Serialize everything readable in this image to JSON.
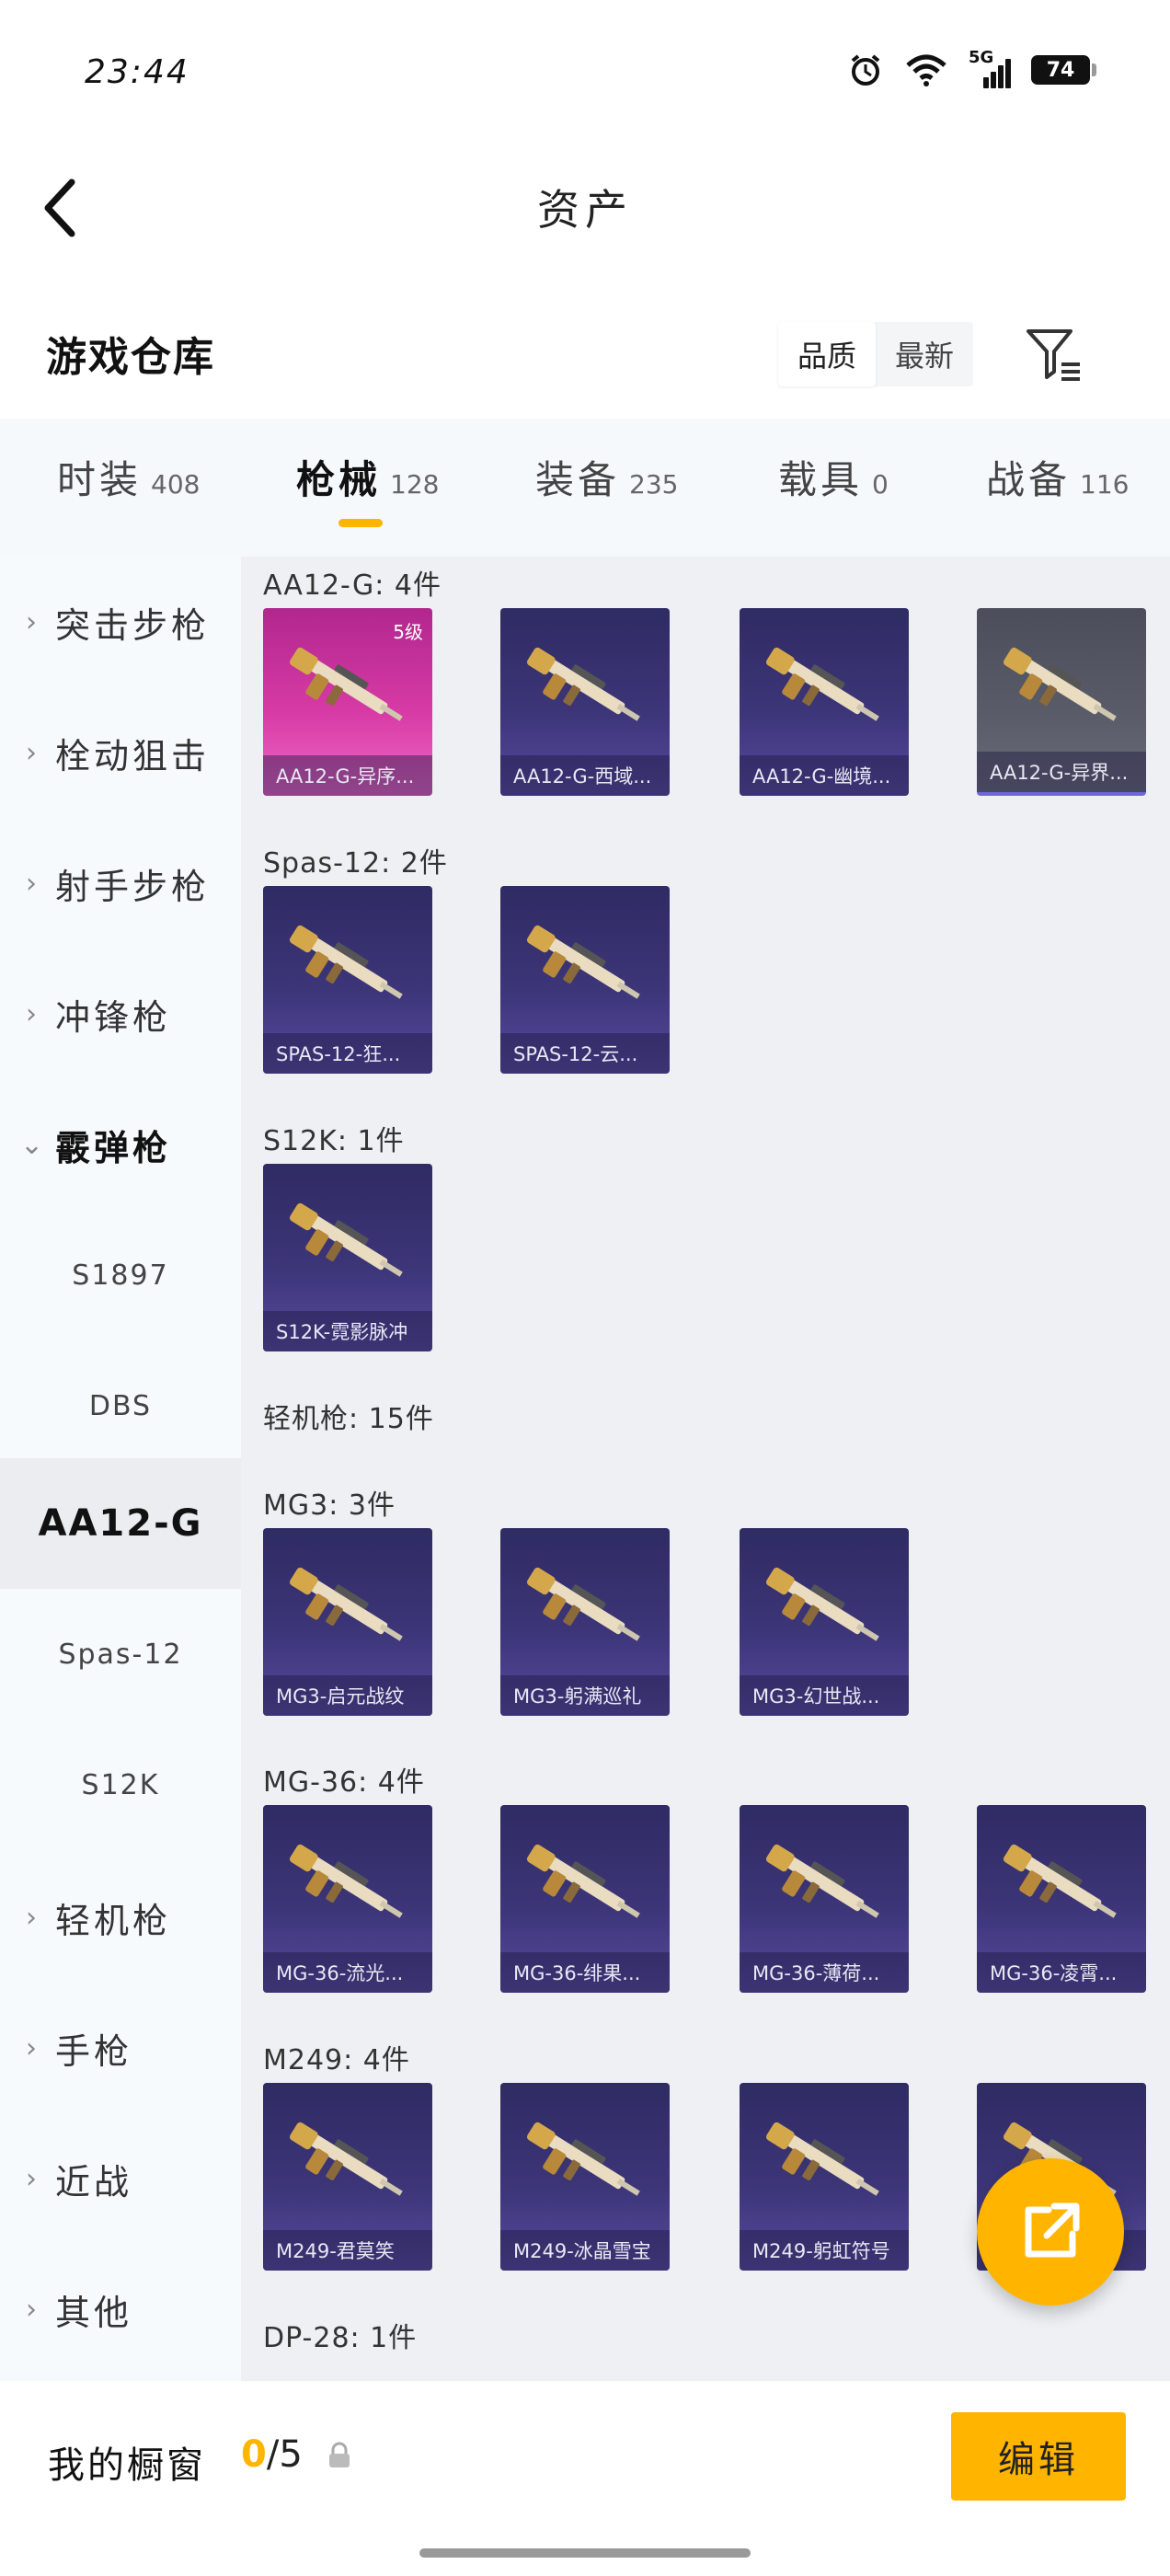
{
  "status_bar": {
    "time": "23:44",
    "network": "5G",
    "battery": "74"
  },
  "header": {
    "title": "资产"
  },
  "warehouse": {
    "title": "游戏仓库",
    "sort_options": [
      {
        "label": "品质",
        "active": true
      },
      {
        "label": "最新",
        "active": false
      }
    ]
  },
  "tabs": [
    {
      "label": "时装",
      "count": "408"
    },
    {
      "label": "枪械",
      "count": "128",
      "active": true
    },
    {
      "label": "装备",
      "count": "235"
    },
    {
      "label": "载具",
      "count": "0"
    },
    {
      "label": "战备",
      "count": "116"
    }
  ],
  "sidebar": {
    "items": [
      {
        "label": "突击步枪"
      },
      {
        "label": "栓动狙击"
      },
      {
        "label": "射手步枪"
      },
      {
        "label": "冲锋枪"
      },
      {
        "label": "霰弹枪",
        "expanded": true
      },
      {
        "label": "S1897",
        "sub": true
      },
      {
        "label": "DBS",
        "sub": true
      },
      {
        "label": "AA12-G",
        "sub": true,
        "active": true
      },
      {
        "label": "Spas-12",
        "sub": true
      },
      {
        "label": "S12K",
        "sub": true
      },
      {
        "label": "轻机枪"
      },
      {
        "label": "手枪"
      },
      {
        "label": "近战"
      },
      {
        "label": "其他"
      }
    ]
  },
  "groups": [
    {
      "label": "AA12-G: 4件",
      "items": [
        {
          "name": "AA12-G-异序...",
          "tier": "5级",
          "theme": "pink"
        },
        {
          "name": "AA12-G-西域...",
          "theme": "purple"
        },
        {
          "name": "AA12-G-幽境...",
          "theme": "purple"
        },
        {
          "name": "AA12-G-异界...",
          "theme": "gray"
        }
      ]
    },
    {
      "label": "Spas-12: 2件",
      "items": [
        {
          "name": "SPAS-12-狂...",
          "theme": "purple"
        },
        {
          "name": "SPAS-12-云...",
          "theme": "purple"
        }
      ]
    },
    {
      "label": "S12K: 1件",
      "items": [
        {
          "name": "S12K-霓影脉冲",
          "theme": "purple"
        }
      ]
    },
    {
      "label": "轻机枪: 15件",
      "items": []
    },
    {
      "label": "MG3: 3件",
      "items": [
        {
          "name": "MG3-启元战纹",
          "theme": "purple"
        },
        {
          "name": "MG3-躬满巡礼",
          "theme": "purple"
        },
        {
          "name": "MG3-幻世战...",
          "theme": "purple"
        }
      ]
    },
    {
      "label": "MG-36: 4件",
      "items": [
        {
          "name": "MG-36-流光...",
          "theme": "purple"
        },
        {
          "name": "MG-36-绯果...",
          "theme": "purple"
        },
        {
          "name": "MG-36-薄荷...",
          "theme": "purple"
        },
        {
          "name": "MG-36-凌霄...",
          "theme": "purple"
        }
      ]
    },
    {
      "label": "M249: 4件",
      "items": [
        {
          "name": "M249-君莫笑",
          "theme": "purple"
        },
        {
          "name": "M249-冰晶雪宝",
          "theme": "purple"
        },
        {
          "name": "M249-躬虹符号",
          "theme": "purple"
        },
        {
          "name": "M249-...灯",
          "theme": "purple"
        }
      ]
    },
    {
      "label": "DP-28: 1件",
      "items": []
    }
  ],
  "bottom": {
    "showcase_label": "我的橱窗",
    "showcase_current": "0",
    "showcase_total": "/5",
    "edit_label": "编辑"
  },
  "colors": {
    "accent": "#ffb400",
    "card_purple": "#3c3578",
    "card_pink": "#d73aa5",
    "card_gray": "#5a5d69"
  }
}
